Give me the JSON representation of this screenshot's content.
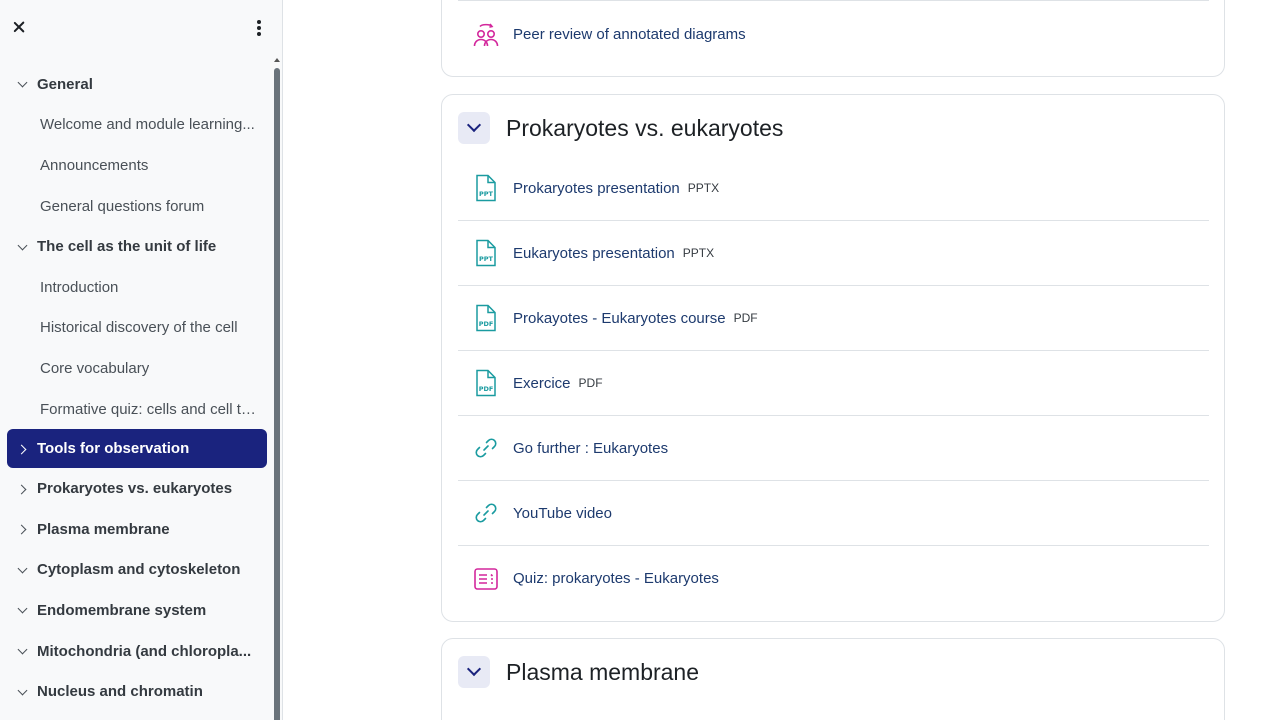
{
  "sidebar": {
    "items": [
      {
        "kind": "section",
        "label": "General",
        "expanded": true
      },
      {
        "kind": "child",
        "label": "Welcome and module learning..."
      },
      {
        "kind": "child",
        "label": "Announcements"
      },
      {
        "kind": "child",
        "label": "General questions forum"
      },
      {
        "kind": "section",
        "label": "The cell as the unit of life",
        "expanded": true
      },
      {
        "kind": "child",
        "label": "Introduction"
      },
      {
        "kind": "child",
        "label": "Historical discovery of the cell"
      },
      {
        "kind": "child",
        "label": "Core vocabulary"
      },
      {
        "kind": "child",
        "label": "Formative quiz: cells and cell th..."
      },
      {
        "kind": "section",
        "label": "Tools for observation",
        "expanded": false,
        "active": true
      },
      {
        "kind": "section",
        "label": "Prokaryotes vs. eukaryotes",
        "expanded": false
      },
      {
        "kind": "section",
        "label": "Plasma membrane",
        "expanded": false
      },
      {
        "kind": "section",
        "label": "Cytoplasm and cytoskeleton",
        "expanded": true
      },
      {
        "kind": "section",
        "label": "Endomembrane system",
        "expanded": true
      },
      {
        "kind": "section",
        "label": "Mitochondria (and chloropla...",
        "expanded": true
      },
      {
        "kind": "section",
        "label": "Nucleus and chromatin",
        "expanded": true
      }
    ]
  },
  "main": {
    "top_card": {
      "activity": {
        "name": "Peer review of annotated diagrams",
        "icon": "workshop-icon"
      }
    },
    "section_prokaryotes": {
      "title": "Prokaryotes vs. eukaryotes",
      "activities": [
        {
          "name": "Prokaryotes presentation",
          "type": "PPTX",
          "icon": "pptx-file-icon"
        },
        {
          "name": "Eukaryotes presentation",
          "type": "PPTX",
          "icon": "pptx-file-icon"
        },
        {
          "name": "Prokayotes - Eukaryotes course",
          "type": "PDF",
          "icon": "pdf-file-icon"
        },
        {
          "name": "Exercice",
          "type": "PDF",
          "icon": "pdf-file-icon"
        },
        {
          "name": "Go further : Eukaryotes",
          "type": "",
          "icon": "link-icon"
        },
        {
          "name": "YouTube video",
          "type": "",
          "icon": "link-icon"
        },
        {
          "name": "Quiz: prokaryotes - Eukaryotes",
          "type": "",
          "icon": "quiz-icon"
        }
      ]
    },
    "section_plasma": {
      "title": "Plasma membrane"
    }
  },
  "colors": {
    "active_nav": "#1a237e",
    "file_icon": "#1a9ba0",
    "assessment_icon": "#d3279c",
    "toggle_bg": "#e8eaf5"
  }
}
